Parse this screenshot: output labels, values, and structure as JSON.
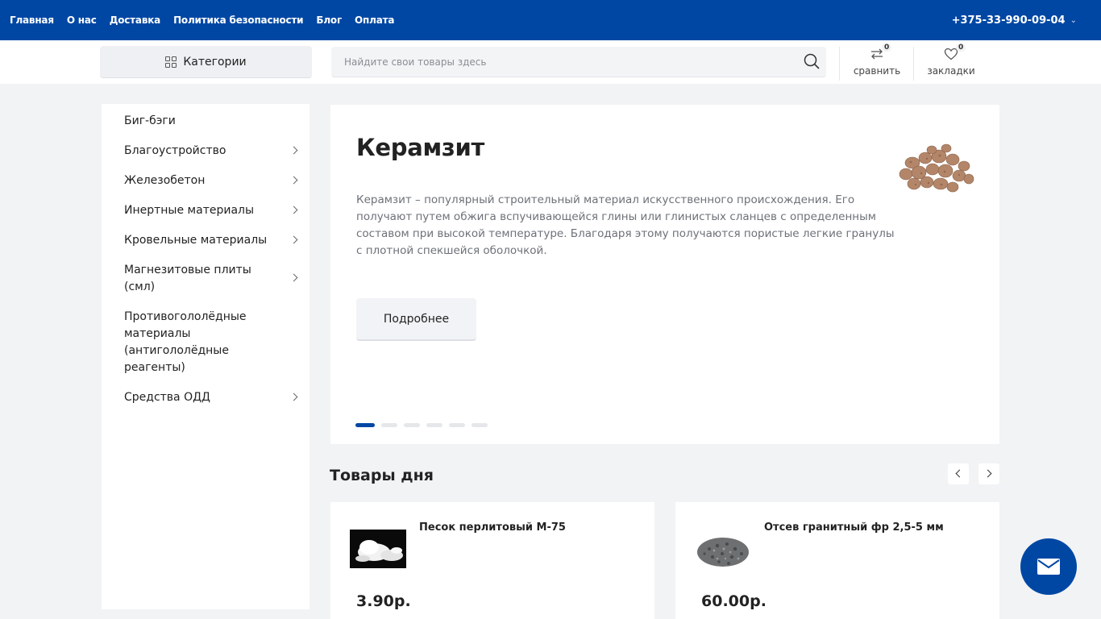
{
  "topnav": {
    "items": [
      "Главная",
      "О нас",
      "Доставка",
      "Политика безопасности",
      "Блог",
      "Оплата"
    ],
    "phone": "+375-33-990-09-04"
  },
  "header": {
    "categories_label": "Категории",
    "search_placeholder": "Найдите свои товары здесь",
    "compare": {
      "label": "сравнить",
      "count": "0"
    },
    "bookmarks": {
      "label": "закладки",
      "count": "0"
    }
  },
  "sidebar": {
    "items": [
      {
        "label": "Биг-бэги"
      },
      {
        "label": "Благоустройство"
      },
      {
        "label": "Железобетон"
      },
      {
        "label": "Инертные материалы"
      },
      {
        "label": "Кровельные материалы"
      },
      {
        "label": "Магнезитовые плиты (смл)"
      },
      {
        "label": "Противогололёдные материалы (антигололёдные реагенты)"
      },
      {
        "label": "Средства ОДД"
      }
    ]
  },
  "slider": {
    "title": "Керамзит",
    "text": "Керамзит – популярный строительный материал искусственного происхождения. Его получают путем обжига вспучивающейся глины или глинистых сланцев с определенным составом при высокой температуре. Благодаря этому получаются пористые легкие гранулы с плотной спекшейся оболочкой.",
    "button": "Подробнее",
    "slides_total": 6,
    "active_slide": 1
  },
  "deals": {
    "title": "Товары дня",
    "products": [
      {
        "name": "Песок перлитовый М-75",
        "price": "3.90р."
      },
      {
        "name": "Отсев гранитный фр 2,5-5 мм",
        "price": "60.00р."
      }
    ]
  },
  "colors": {
    "brand": "#0047a4",
    "background": "#f2f3f5"
  }
}
